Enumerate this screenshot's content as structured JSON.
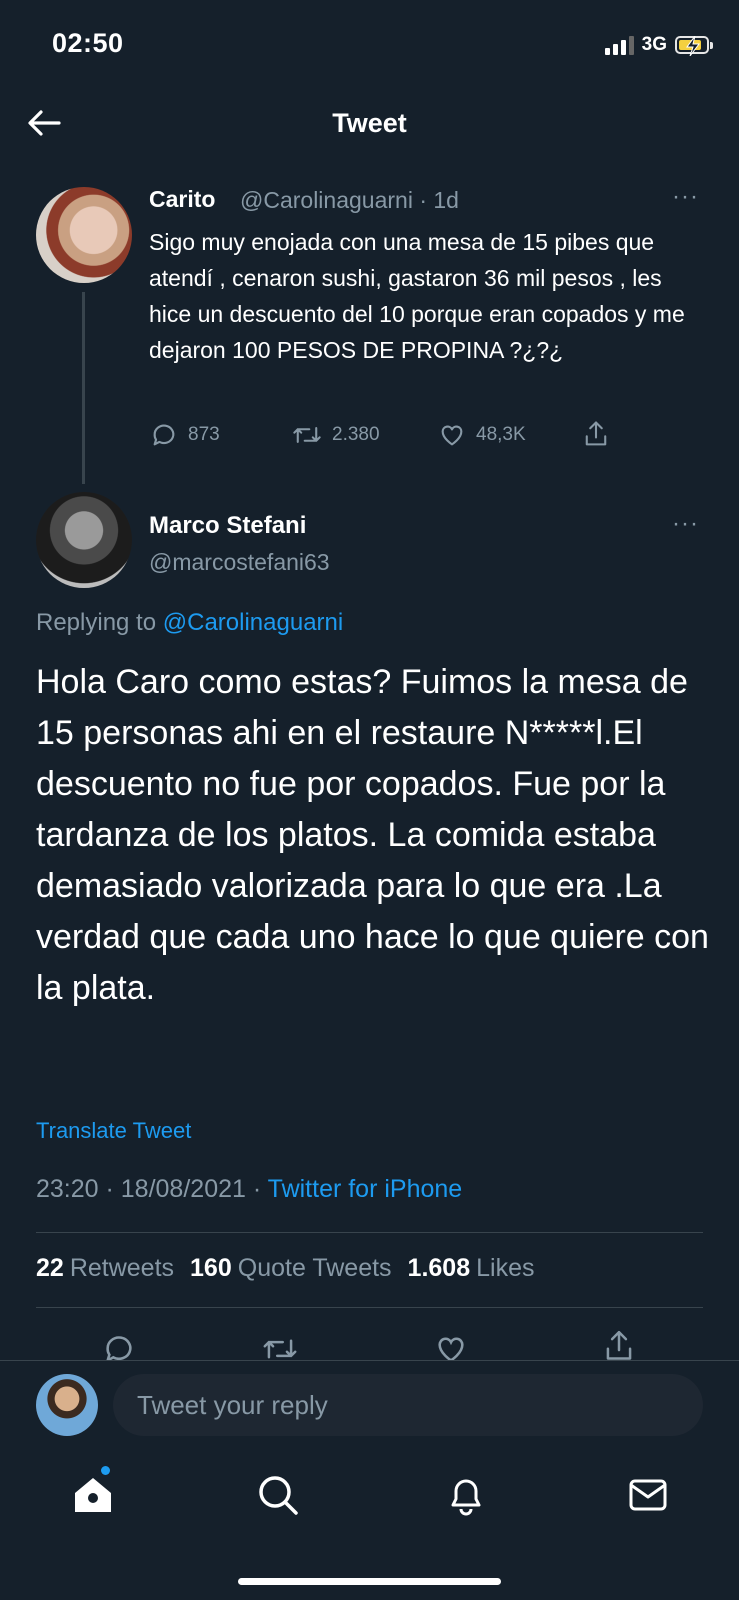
{
  "status_bar": {
    "time": "02:50",
    "network": "3G"
  },
  "header": {
    "title": "Tweet"
  },
  "parent_tweet": {
    "name": "Carito",
    "handle_time": "@Carolinaguarni · 1d",
    "text": "Sigo muy enojada con una mesa de 15 pibes que atendí , cenaron sushi, gastaron 36 mil pesos , les hice un descuento del 10 porque eran copados y me dejaron 100 PESOS DE PROPINA ?¿?¿",
    "replies": "873",
    "retweets": "2.380",
    "likes": "48,3K"
  },
  "main_tweet": {
    "name": "Marco Stefani",
    "handle": "@marcostefani63",
    "replying_prefix": "Replying to ",
    "replying_to": "@Carolinaguarni",
    "text": "Hola Caro como estas? Fuimos la mesa de 15 personas ahi en el restaure N*****l.El descuento no fue por copados. Fue por la tardanza de los platos. La comida estaba demasiado valorizada para lo que era .La verdad que cada uno hace lo que quiere con la plata.",
    "translate": "Translate Tweet",
    "timestamp": "23:20 · 18/08/2021 · ",
    "source": "Twitter for iPhone",
    "retweets_count": "22",
    "retweets_label": "Retweets",
    "quotes_count": "160",
    "quotes_label": "Quote Tweets",
    "likes_count": "1.608",
    "likes_label": "Likes"
  },
  "compose": {
    "placeholder": "Tweet your reply"
  },
  "more_label": "···",
  "colors": {
    "background": "#15202b",
    "accent": "#1d9bf0",
    "muted": "#8899a6",
    "divider": "#38444d"
  },
  "icons": [
    "back-arrow-icon",
    "reply-icon",
    "retweet-icon",
    "like-icon",
    "share-icon",
    "home-icon",
    "search-icon",
    "notifications-icon",
    "messages-icon"
  ]
}
